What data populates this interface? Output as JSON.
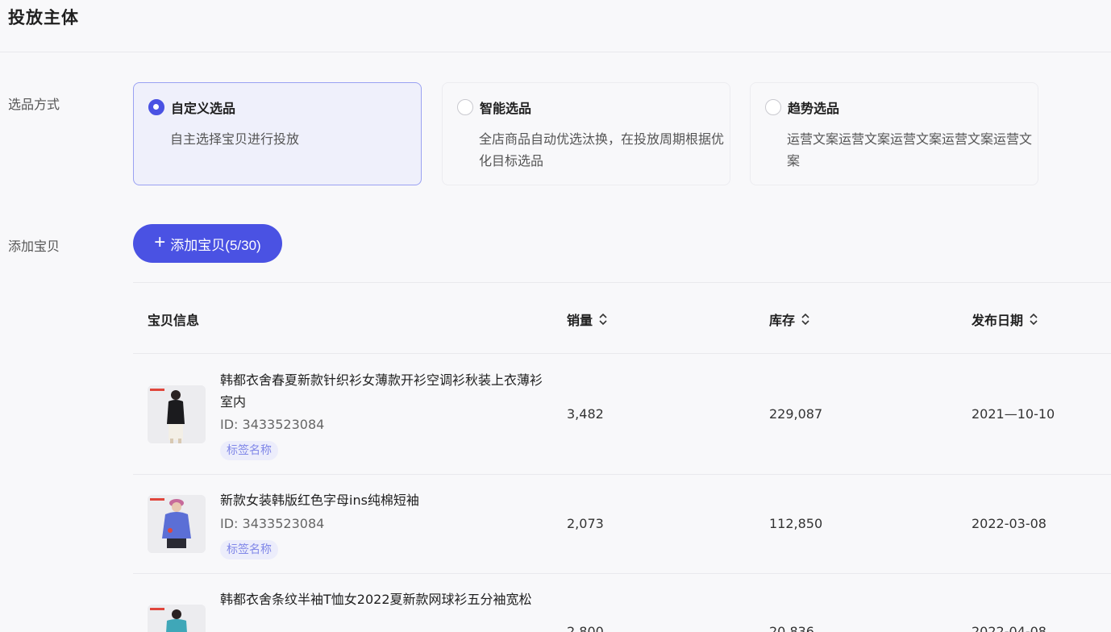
{
  "section": {
    "title": "投放主体"
  },
  "selection": {
    "label": "选品方式",
    "options": [
      {
        "title": "自定义选品",
        "desc": "自主选择宝贝进行投放",
        "selected": true
      },
      {
        "title": "智能选品",
        "desc": "全店商品自动优选汰换，在投放周期根据优化目标选品",
        "selected": false
      },
      {
        "title": "趋势选品",
        "desc": "运营文案运营文案运营文案运营文案运营文案",
        "selected": false
      }
    ]
  },
  "add": {
    "label": "添加宝贝",
    "button_label": "添加宝贝(5/30)",
    "icon": "plus-icon"
  },
  "table": {
    "headers": {
      "info": "宝贝信息",
      "sales": "销量",
      "stock": "库存",
      "date": "发布日期"
    },
    "rows": [
      {
        "name": "韩都衣舍春夏新款针织衫女薄款开衫空调衫秋装上衣薄衫室内",
        "id": "ID: 3433523084",
        "tag": "标签名称",
        "sales": "3,482",
        "stock": "229,087",
        "date": "2021—10-10",
        "thumb_style": "black-top"
      },
      {
        "name": "新款女装韩版红色字母ins纯棉短袖",
        "id": "ID: 3433523084",
        "tag": "标签名称",
        "sales": "2,073",
        "stock": "112,850",
        "date": "2022-03-08",
        "thumb_style": "blue-sweater"
      },
      {
        "name": "韩都衣舍条纹半袖T恤女2022夏新款网球衫五分袖宽松",
        "id": "",
        "tag": "",
        "sales": "2,800",
        "stock": "20,836",
        "date": "2022-04-08",
        "thumb_style": "teal-top"
      }
    ]
  },
  "colors": {
    "accent": "#4a52e3",
    "selected_card_bg": "#eff0fb",
    "tag_bg": "#ecedfb",
    "tag_text": "#8087e8"
  }
}
